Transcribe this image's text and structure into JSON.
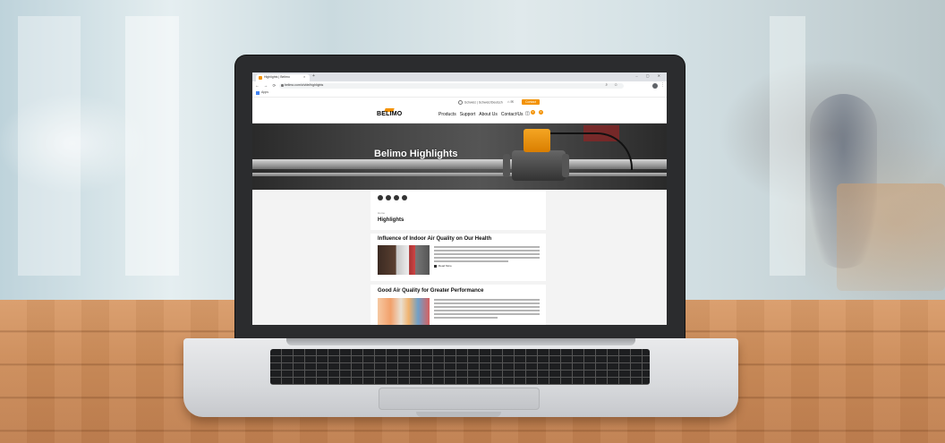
{
  "browser": {
    "tab_title": "Highlights | Belimo",
    "new_tab": "+",
    "window_controls": "– ▢ ✕",
    "nav_buttons": "← → ⟳ ⌂",
    "url": "belimo.com/ch/de/highlights",
    "url_icons": "⌕ ☆",
    "menu": "⋮",
    "bookmarks_label": "Apps"
  },
  "site": {
    "region_selector": "Schweiz | Schweiz/Deutsch",
    "contact_button": "Contact",
    "logo": "BELIMO",
    "nav": [
      "Products",
      "Support",
      "About Us",
      "Contact Us"
    ],
    "search_icon": "⌕",
    "cart_icon": "🛒",
    "badges": [
      "0",
      "0"
    ],
    "hero_title": "Belimo Highlights",
    "breadcrumb": "Home",
    "page_title": "Highlights",
    "articles": [
      {
        "title": "Influence of Indoor Air Quality on Our Health",
        "read_more": "Read More"
      },
      {
        "title": "Good Air Quality for Greater Performance"
      }
    ]
  },
  "colors": {
    "brand_orange": "#f39200",
    "page_bg": "#f3f3f3"
  }
}
